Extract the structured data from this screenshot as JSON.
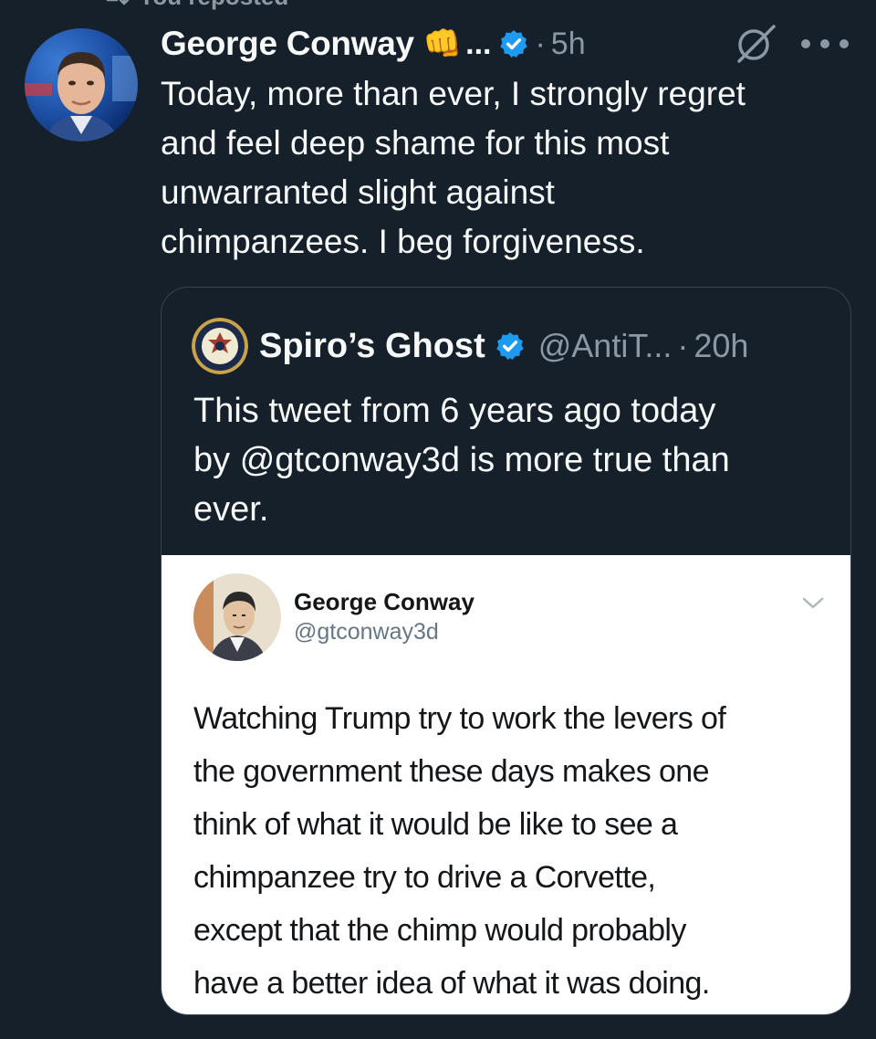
{
  "colors": {
    "background": "#15202b",
    "text_primary": "#f7f9f9",
    "text_secondary": "#8b98a5",
    "verified_blue": "#1d9bf0",
    "card_border": "#38444d"
  },
  "repost": {
    "icon": "repost-icon",
    "label": "You reposted"
  },
  "tweet": {
    "author_name": "George Conway",
    "emoji": "👊",
    "name_ellipsis": "...",
    "separator": "·",
    "time": "5h",
    "icons": [
      "verified-badge-icon",
      "grok-icon",
      "more-options-icon"
    ],
    "text": "Today, more than ever, I strongly regret\nand feel deep shame for this most\nunwarranted slight against\nchimpanzees.  I beg forgiveness."
  },
  "quote": {
    "author_name": "Spiro’s Ghost",
    "handle": "@AntiT...",
    "separator": "·",
    "time": "20h",
    "text": "This tweet from 6 years ago today\nby @gtconway3d is more true than\never.",
    "embedded_tweet": {
      "author_name": "George Conway",
      "handle": "@gtconway3d",
      "text": "Watching Trump try to work the levers of\nthe government these days makes one\nthink of what it would be like to see a\nchimpanzee try to drive a Corvette,\nexcept that the chimp would probably\nhave a better idea of what it was doing."
    }
  }
}
